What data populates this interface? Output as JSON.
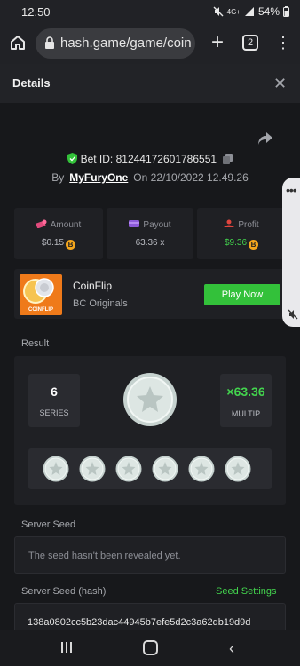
{
  "status_bar": {
    "time": "12.50",
    "network": "4G+",
    "battery": "54%",
    "icons": [
      "mute-icon",
      "signal-icon",
      "battery-icon"
    ]
  },
  "browser": {
    "url": "hash.game/game/coin",
    "tab_count": "2",
    "icons": [
      "home-icon",
      "lock-icon",
      "plus-icon",
      "tabs-icon",
      "more-vert-icon"
    ]
  },
  "details": {
    "title": "Details",
    "close_icon": "close-icon"
  },
  "bet": {
    "id_label": "Bet ID: ",
    "id_value": "81244172601786551",
    "by_label": "By",
    "user": "MyFuryOne",
    "on_label": "On",
    "datetime": "22/10/2022 12.49.26"
  },
  "stats": {
    "amount_label": "Amount",
    "amount_value": "$0.15",
    "payout_label": "Payout",
    "payout_value": "63.36 x",
    "profit_label": "Profit",
    "profit_value": "$9.36"
  },
  "game": {
    "name": "CoinFlip",
    "provider": "BC Originals",
    "play_label": "Play Now",
    "thumb_label": "COINFLIP"
  },
  "result": {
    "label": "Result",
    "series_value": "6",
    "series_label": "SERIES",
    "multiplier_value": "×63.36",
    "multiplier_label": "MULTIP",
    "coin_count": 6
  },
  "seeds": {
    "server_seed_label": "Server Seed",
    "server_seed_text": "The seed hasn't been revealed yet.",
    "hash_label": "Server Seed (hash)",
    "seed_settings_label": "Seed Settings",
    "hash_value": "138a0802cc5b23dac44945b7efe5d2c3a62db19d9d"
  },
  "colors": {
    "background": "#17181b",
    "panel": "#1f2024",
    "accent_green": "#33c13a",
    "profit_green": "#43d44e",
    "coin_gold": "#f4a61d"
  }
}
